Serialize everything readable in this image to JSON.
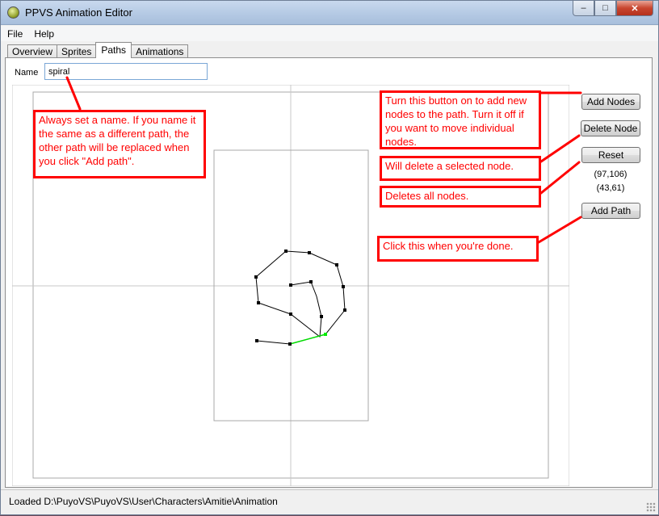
{
  "window": {
    "title": "PPVS Animation Editor",
    "controls": {
      "minimize": "–",
      "maximize": "□",
      "close": "✕"
    }
  },
  "menu": [
    {
      "label": "File"
    },
    {
      "label": "Help"
    }
  ],
  "tabs": [
    {
      "label": "Overview",
      "active": false
    },
    {
      "label": "Sprites",
      "active": false
    },
    {
      "label": "Paths",
      "active": true
    },
    {
      "label": "Animations",
      "active": false
    }
  ],
  "name_field": {
    "label": "Name",
    "value": "spiral"
  },
  "buttons": {
    "add_nodes": "Add Nodes",
    "delete_node": "Delete Node",
    "reset": "Reset",
    "add_path": "Add Path"
  },
  "coordinates": {
    "first": "(97,106)",
    "second": "(43,61)"
  },
  "annotations": {
    "name": "Always set a name. If you name it the same as a different path, the other path will be replaced when you click \"Add path\".",
    "add_nodes": "Turn this button on to add new nodes to the path. Turn it off if you want to move individual nodes.",
    "delete_node": "Will delete a selected node.",
    "reset": "Deletes all nodes.",
    "add_path": "Click this when you're done."
  },
  "status": {
    "text": "Loaded D:\\PuyoVS\\PuyoVS\\User\\Characters\\Amitie\\Animation"
  },
  "colors": {
    "annotation": "#ff0000",
    "path_line": "#000000",
    "selected_segment": "#00cc00",
    "accent": "#7aa7d6"
  }
}
